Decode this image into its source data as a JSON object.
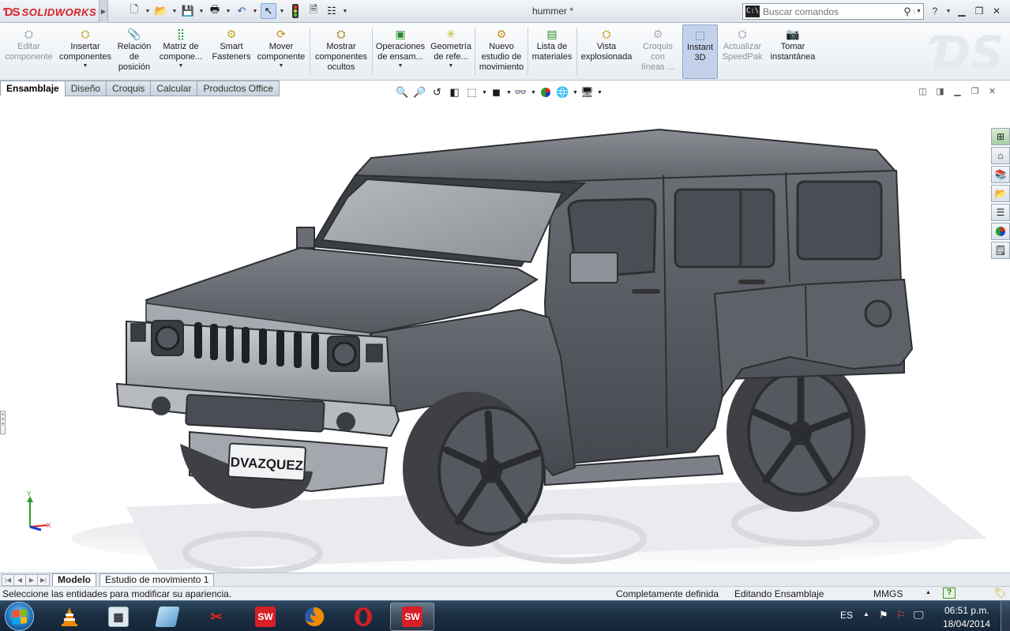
{
  "app": {
    "brand": "SOLIDWORKS",
    "document_title": "hummer *"
  },
  "quick_access": [
    {
      "icon": "new-document-icon"
    },
    {
      "icon": "open-folder-icon"
    },
    {
      "icon": "save-icon"
    },
    {
      "icon": "print-icon"
    },
    {
      "icon": "undo-icon"
    },
    {
      "icon": "select-arrow-icon"
    },
    {
      "icon": "rebuild-traffic-light-icon"
    },
    {
      "icon": "file-properties-icon"
    },
    {
      "icon": "options-icon"
    }
  ],
  "search": {
    "placeholder": "Buscar comandos"
  },
  "command_manager": [
    {
      "label": "Editar\ncomponente",
      "disabled": true,
      "dropdown": false
    },
    {
      "label": "Insertar\ncomponentes",
      "disabled": false,
      "dropdown": true
    },
    {
      "label": "Relación\nde\nposición",
      "disabled": false,
      "dropdown": false
    },
    {
      "label": "Matriz de\ncompone...",
      "disabled": false,
      "dropdown": true
    },
    {
      "label": "Smart\nFasteners",
      "disabled": false,
      "dropdown": false
    },
    {
      "label": "Mover\ncomponente",
      "disabled": false,
      "dropdown": true
    },
    {
      "label": "Mostrar\ncomponentes\nocultos",
      "disabled": false,
      "dropdown": false
    },
    {
      "label": "Operaciones\nde ensam...",
      "disabled": false,
      "dropdown": true
    },
    {
      "label": "Geometría\nde refe...",
      "disabled": false,
      "dropdown": true
    },
    {
      "label": "Nuevo\nestudio de\nmovimiento",
      "disabled": false,
      "dropdown": false
    },
    {
      "label": "Lista de\nmateriales",
      "disabled": false,
      "dropdown": false
    },
    {
      "label": "Vista\nexplosionada",
      "disabled": false,
      "dropdown": false
    },
    {
      "label": "Croquis\ncon\nlíneas ...",
      "disabled": true,
      "dropdown": false
    },
    {
      "label": "Instant\n3D",
      "disabled": false,
      "dropdown": false,
      "pressed": true
    },
    {
      "label": "Actualizar\nSpeedPak",
      "disabled": true,
      "dropdown": false
    },
    {
      "label": "Tomar\ninstantánea",
      "disabled": false,
      "dropdown": false
    }
  ],
  "command_tabs": [
    {
      "label": "Ensamblaje",
      "active": true
    },
    {
      "label": "Diseño",
      "active": false
    },
    {
      "label": "Croquis",
      "active": false
    },
    {
      "label": "Calcular",
      "active": false
    },
    {
      "label": "Productos Office",
      "active": false
    }
  ],
  "model": {
    "license_plate": "DVAZQUEZ",
    "triad": {
      "y_label": "Y",
      "x_label": "X"
    }
  },
  "bottom_tabs": [
    {
      "label": "Modelo",
      "active": true
    },
    {
      "label": "Estudio de movimiento 1",
      "active": false
    }
  ],
  "status": {
    "hint": "Seleccione las entidades para modificar su apariencia.",
    "definition": "Completamente definida",
    "mode": "Editando Ensamblaje",
    "units": "MMGS",
    "units_arrow": "▲",
    "help": "?"
  },
  "taskbar": {
    "apps": [
      {
        "name": "taskbar-vlc",
        "icon": "vlc-cone-icon"
      },
      {
        "name": "taskbar-calculator",
        "icon": "calculator-icon"
      },
      {
        "name": "taskbar-notes",
        "icon": "notes-icon"
      },
      {
        "name": "taskbar-snipping-tool",
        "icon": "scissors-icon"
      },
      {
        "name": "taskbar-solidworks",
        "icon": "solidworks-icon",
        "label": "SW"
      },
      {
        "name": "taskbar-firefox",
        "icon": "firefox-icon"
      },
      {
        "name": "taskbar-opera",
        "icon": "opera-icon"
      },
      {
        "name": "taskbar-solidworks-2",
        "icon": "solidworks-icon",
        "label": "SW",
        "active": true
      }
    ],
    "language": "ES",
    "time": "06:51 p.m.",
    "date": "18/04/2014"
  },
  "colors": {
    "brand_red": "#d61f26",
    "body_gray": "#55585f",
    "ui_blue": "#c3d2ea"
  }
}
